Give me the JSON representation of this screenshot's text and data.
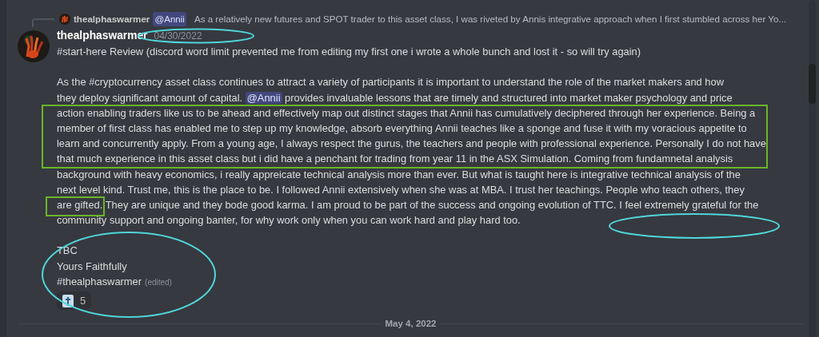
{
  "reply": {
    "author": "thealphaswarmer",
    "mention": "@Annii",
    "preview": "As a relatively new futures and SPOT trader to this asset class, I was riveted by Annis integrative approach when I first stumbled across her Yo..."
  },
  "message": {
    "author": "thealphaswarmer",
    "timestamp": "04/30/2022",
    "paragraphs": [
      {
        "lines": [
          {
            "segments": [
              {
                "kind": "text",
                "text": "#start-here  Review (discord word limit prevented me from editing my first one i wrote a whole bunch and lost it - so will try again)"
              }
            ]
          }
        ]
      },
      {
        "lines": [
          {
            "segments": [
              {
                "kind": "text",
                "text": "As the #cryptocurrency  asset class continues to attract a variety of participants it is important to understand  the role of the market makers and how"
              }
            ]
          },
          {
            "segments": [
              {
                "kind": "text",
                "text": "they deploy significant amount of capital. "
              },
              {
                "kind": "mention",
                "text": "@Annii"
              },
              {
                "kind": "text",
                "text": "  provides invaluable lessons that are timely and structured into market maker psychology and price"
              }
            ]
          },
          {
            "segments": [
              {
                "kind": "text",
                "text": "action enabling traders like us to be ahead and effectively map out distinct stages that Annii has cumulatively deciphered through her experience. Being a"
              }
            ]
          },
          {
            "segments": [
              {
                "kind": "text",
                "text": "member of first class has enabled me to step up my knowledge, absorb everything Annii teaches like a sponge and fuse it with my voracious appetite to"
              }
            ]
          },
          {
            "segments": [
              {
                "kind": "text",
                "text": "learn and concurrently apply. From a young age, I always respect the gurus, the teachers and people with professional experience. Personally I do not have"
              }
            ]
          },
          {
            "segments": [
              {
                "kind": "text",
                "text": "that much experience in this asset class but i did have a penchant for trading from year 11 in the ASX Simulation. Coming from fundamnetal analysis"
              }
            ]
          },
          {
            "segments": [
              {
                "kind": "text",
                "text": "background with heavy economics, i really appreicate technical analysis more than ever. But what is taught here is integrative technical analysis of the"
              }
            ]
          },
          {
            "segments": [
              {
                "kind": "text",
                "text": "next level kind. Trust me, this is the place to be. I followed Annii extensively when she was at MBA. I trust her teachings. People who teach others, they"
              }
            ]
          },
          {
            "segments": [
              {
                "kind": "text",
                "text": "are gifted. They are unique and they bode good karma. I am proud to be part of the success and ongoing evolution of TTC. I feel extremely grateful for the"
              }
            ]
          },
          {
            "segments": [
              {
                "kind": "text",
                "text": "community support and ongoing banter, for why work only when you can work hard and play hard too."
              }
            ]
          }
        ]
      },
      {
        "lines": [
          {
            "segments": [
              {
                "kind": "text",
                "text": "TBC"
              }
            ]
          },
          {
            "segments": [
              {
                "kind": "text",
                "text": "Yours Faithfully"
              }
            ]
          },
          {
            "segments": [
              {
                "kind": "text",
                "text": "#thealphaswarmer"
              },
              {
                "kind": "edited",
                "text": "(edited)"
              }
            ]
          }
        ]
      }
    ],
    "reactions": [
      {
        "count": "5"
      }
    ]
  },
  "divider": {
    "date": "May 4, 2022"
  },
  "annotations": [
    {
      "kind": "ellipse",
      "color": "#4fd6da"
    },
    {
      "kind": "rect",
      "color": "#6bb52a"
    },
    {
      "kind": "rect",
      "color": "#6bb52a"
    },
    {
      "kind": "ellipse",
      "color": "#4fd6da"
    },
    {
      "kind": "ellipse",
      "color": "#4fd6da"
    }
  ]
}
